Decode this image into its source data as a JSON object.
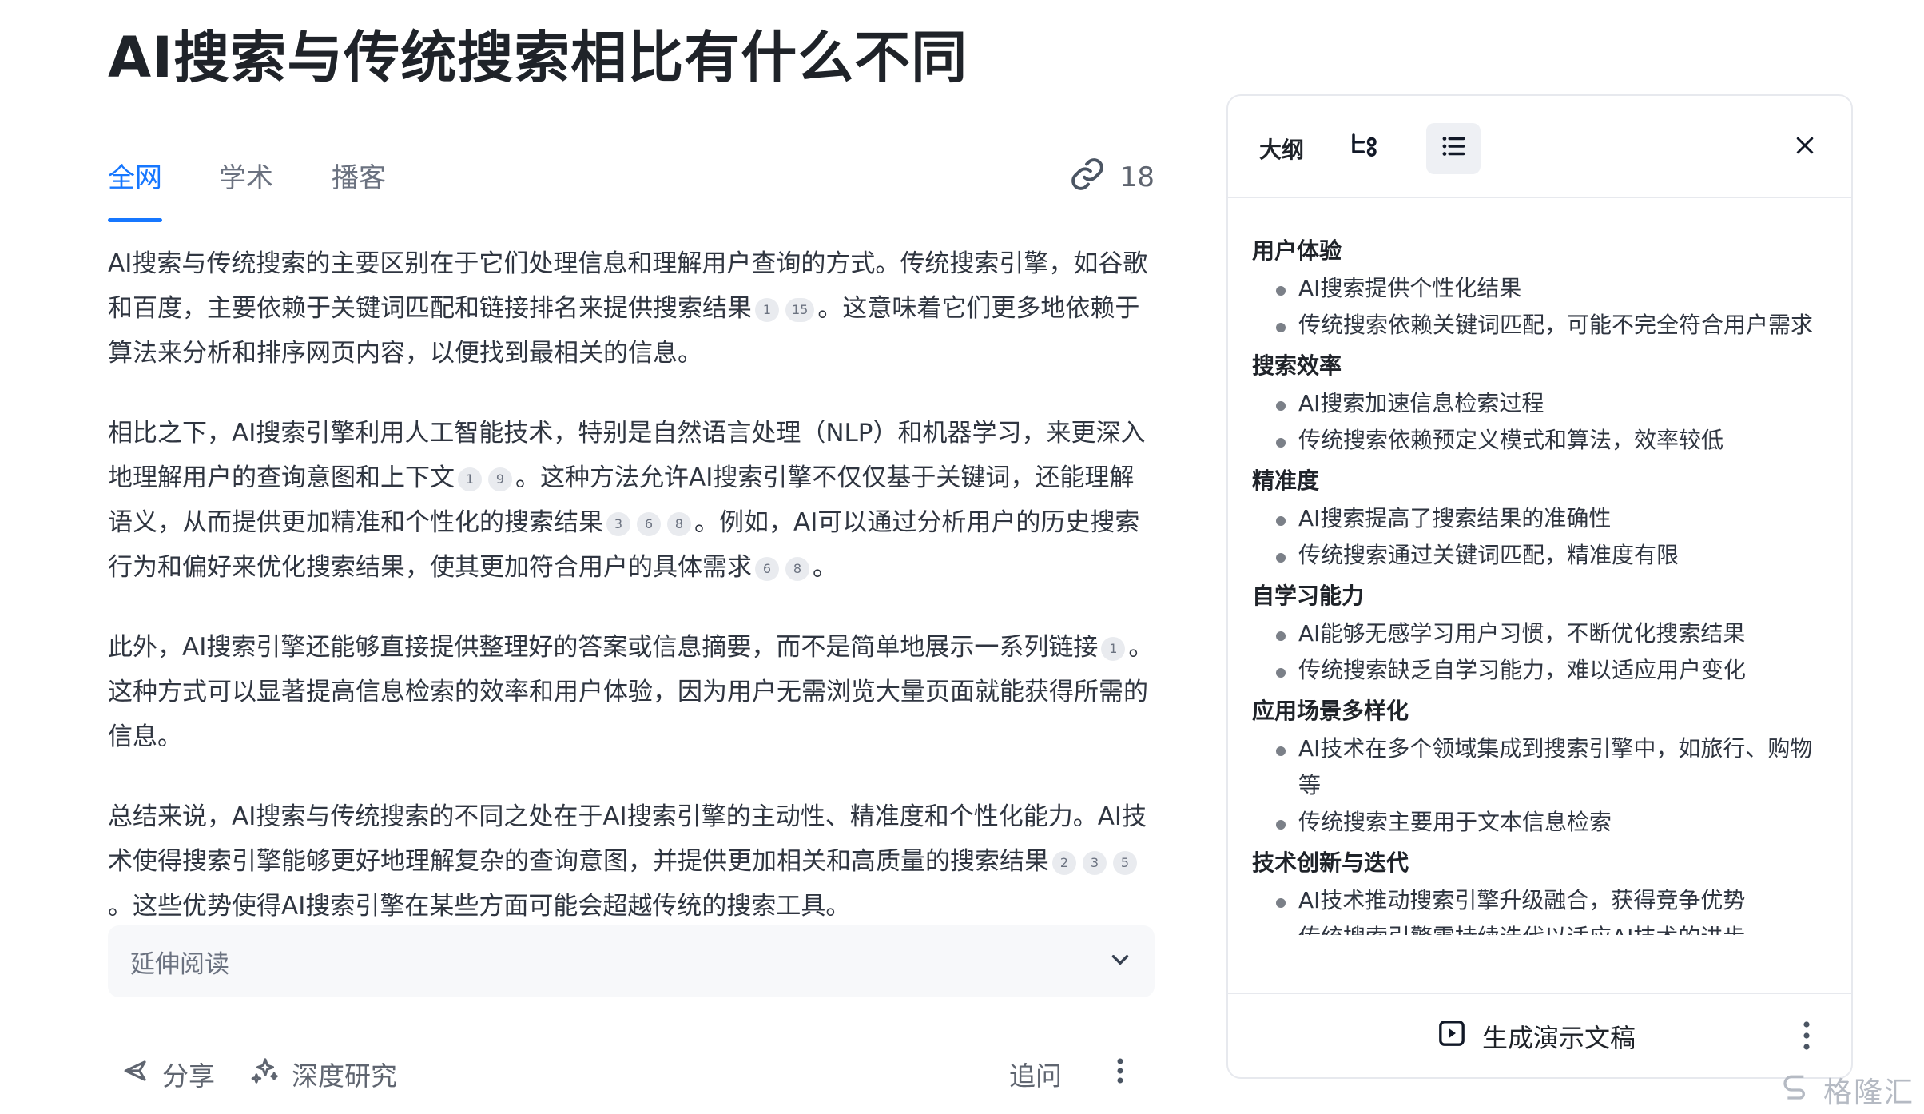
{
  "page": {
    "title": "AI搜索与传统搜索相比有什么不同"
  },
  "tabs": [
    {
      "label": "全网"
    },
    {
      "label": "学术"
    },
    {
      "label": "播客"
    }
  ],
  "sources": {
    "count": "18"
  },
  "article": {
    "p1": {
      "a": "AI搜索与传统搜索的主要区别在于它们处理信息和理解用户查询的方式。传统搜索引擎，如谷歌和百度，主要依赖于关键词匹配和链接排名来提供搜索结果",
      "c1": "1",
      "c2": "15",
      "b": "。这意味着它们更多地依赖于算法来分析和排序网页内容，以便找到最相关的信息。"
    },
    "p2": {
      "a": "相比之下，AI搜索引擎利用人工智能技术，特别是自然语言处理（NLP）和机器学习，来更深入地理解用户的查询意图和上下文",
      "c1": "1",
      "c2": "9",
      "b": "。这种方法允许AI搜索引擎不仅仅基于关键词，还能理解语义，从而提供更加精准和个性化的搜索结果",
      "c3": "3",
      "c4": "6",
      "c5": "8",
      "c": "。例如，AI可以通过分析用户的历史搜索行为和偏好来优化搜索结果，使其更加符合用户的具体需求",
      "c6": "6",
      "c7": "8",
      "d": "。"
    },
    "p3": {
      "a": "此外，AI搜索引擎还能够直接提供整理好的答案或信息摘要，而不是简单地展示一系列链接",
      "c1": "1",
      "b": "。这种方式可以显著提高信息检索的效率和用户体验，因为用户无需浏览大量页面就能获得所需的信息。"
    },
    "p4": {
      "a": "总结来说，AI搜索与传统搜索的不同之处在于AI搜索引擎的主动性、精准度和个性化能力。AI技术使得搜索引擎能够更好地理解复杂的查询意图，并提供更加相关和高质量的搜索结果",
      "c1": "2",
      "c2": "3",
      "c3": "5",
      "b": "。这些优势使得AI搜索引擎在某些方面可能会超越传统的搜索工具。"
    }
  },
  "extended_reading": {
    "label": "延伸阅读"
  },
  "actions": {
    "share": "分享",
    "deep_research": "深度研究",
    "follow_up": "追问"
  },
  "outline_panel": {
    "tab_outline": "大纲",
    "generate": "生成演示文稿",
    "sections": [
      {
        "title": "用户体验",
        "items": [
          "AI搜索提供个性化结果",
          "传统搜索依赖关键词匹配，可能不完全符合用户需求"
        ]
      },
      {
        "title": "搜索效率",
        "items": [
          "AI搜索加速信息检索过程",
          "传统搜索依赖预定义模式和算法，效率较低"
        ]
      },
      {
        "title": "精准度",
        "items": [
          "AI搜索提高了搜索结果的准确性",
          "传统搜索通过关键词匹配，精准度有限"
        ]
      },
      {
        "title": "自学习能力",
        "items": [
          "AI能够无感学习用户习惯，不断优化搜索结果",
          "传统搜索缺乏自学习能力，难以适应用户变化"
        ]
      },
      {
        "title": "应用场景多样化",
        "items": [
          "AI技术在多个领域集成到搜索引擎中，如旅行、购物等",
          "传统搜索主要用于文本信息检索"
        ]
      },
      {
        "title": "技术创新与迭代",
        "items": [
          "AI技术推动搜索引擎升级融合，获得竞争优势",
          "传统搜索引擎需持续迭代以适应AI技术的进步"
        ]
      }
    ]
  },
  "watermark": {
    "text": "格隆汇"
  },
  "colors": {
    "accent": "#1677ff",
    "text": "#1f2329",
    "muted": "#6b7280"
  },
  "icons": [
    "link-icon",
    "chevron-down-icon",
    "share-icon",
    "sparkle-icon",
    "more-vertical-icon",
    "mindmap-icon",
    "list-icon",
    "close-icon",
    "presentation-icon",
    "watermark-logo"
  ]
}
